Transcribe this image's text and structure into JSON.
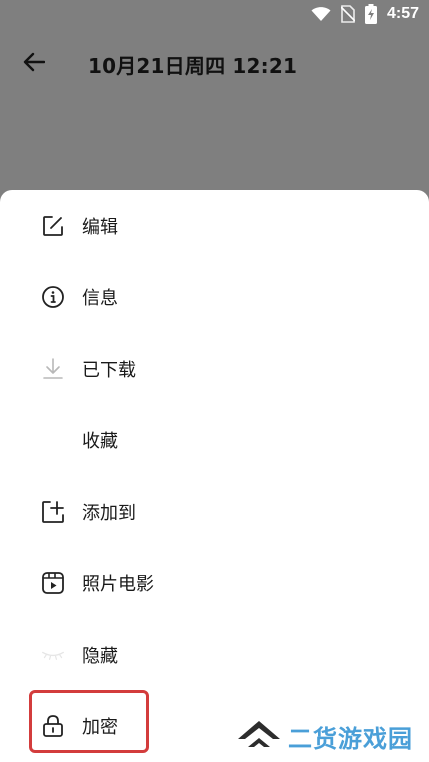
{
  "status_bar": {
    "time": "4:57",
    "icons": [
      "wifi-icon",
      "no-sim-icon",
      "battery-charging-icon"
    ]
  },
  "header": {
    "back_icon": "arrow-left-icon",
    "title": "10月21日周四 12:21"
  },
  "menu": {
    "items": [
      {
        "label": "编辑",
        "icon": "edit-icon"
      },
      {
        "label": "信息",
        "icon": "info-icon"
      },
      {
        "label": "已下载",
        "icon": "download-icon"
      },
      {
        "label": "收藏",
        "icon": ""
      },
      {
        "label": "添加到",
        "icon": "add-to-icon"
      },
      {
        "label": "照片电影",
        "icon": "photo-movie-icon"
      },
      {
        "label": "隐藏",
        "icon": "hidden-eye-icon"
      },
      {
        "label": "加密",
        "icon": "lock-icon"
      }
    ]
  },
  "highlight": {
    "color": "#d33c3c"
  },
  "watermark": {
    "text": "二货游戏园",
    "color": "#4a9fd8",
    "logo_color": "#2d2d2d"
  },
  "colors": {
    "scrim": "#7f7f7f",
    "sheet": "#ffffff",
    "text": "#1a1a1a"
  }
}
